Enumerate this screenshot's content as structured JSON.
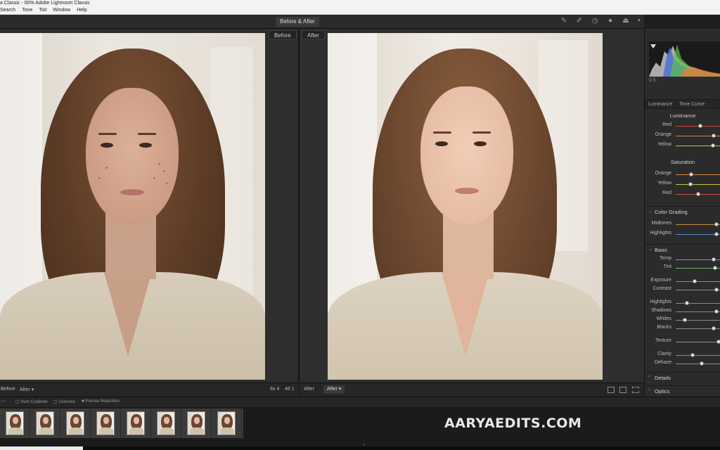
{
  "window": {
    "title": "a Classic - 00% Adobe Lightroom Classic"
  },
  "menu": [
    "Search",
    "Tone",
    "Toit",
    "Window",
    "Help"
  ],
  "toolbar": {
    "view_mode": "Before & After"
  },
  "tool_icons": [
    "brush-icon",
    "pen-icon",
    "clock-icon",
    "info-icon",
    "share-icon",
    "chevron-down-icon"
  ],
  "panes": {
    "before_label": "Before",
    "after_label": "After"
  },
  "bottom_left": {
    "label": "Before",
    "select": "After",
    "zoom": "6x 4",
    "count": "46 1"
  },
  "bottom_right": {
    "label": "After",
    "select": "After"
  },
  "panel": {
    "hist_code": "0 5",
    "tabs": [
      "Luminance",
      "Tone Curve"
    ],
    "luminance": {
      "heading": "Luminance",
      "sliders": [
        {
          "label": "Red",
          "value": 0.55,
          "color": "#d04a4a"
        },
        {
          "label": "Orange",
          "value": 0.85,
          "color": "#d9873a"
        },
        {
          "label": "Yellow",
          "value": 0.83,
          "color": "#c9c13c"
        }
      ]
    },
    "saturation": {
      "heading": "Saturation",
      "sliders": [
        {
          "label": "Orange",
          "value": 0.35,
          "color": "#d9873a"
        },
        {
          "label": "Yellow",
          "value": 0.33,
          "color": "#c9c13c"
        },
        {
          "label": "Red",
          "value": 0.5,
          "color": "#d04a4a"
        }
      ]
    },
    "color_grading": {
      "title": "Color Grading",
      "sliders": [
        {
          "label": "Midtones",
          "value": 0.9,
          "color": "#c98a4a"
        },
        {
          "label": "Highlights",
          "value": 0.9,
          "color": "#5f86c9"
        }
      ]
    },
    "basic": {
      "title": "Basic",
      "sliders": [
        {
          "label": "Temp",
          "value": 0.85,
          "color": "#5f9bd0"
        },
        {
          "label": "Tint",
          "value": 0.88,
          "color": "#6fb26c"
        },
        {
          "label": "Exposure",
          "value": 0.42,
          "color": "#8a8a8a"
        },
        {
          "label": "Contrast",
          "value": 0.9,
          "color": "#8a8a8a"
        },
        {
          "label": "Highlights",
          "value": 0.25,
          "color": "#8a8a8a"
        },
        {
          "label": "Shadows",
          "value": 0.9,
          "color": "#8a8a8a"
        },
        {
          "label": "Whites",
          "value": 0.2,
          "color": "#8a8a8a"
        },
        {
          "label": "Blacks",
          "value": 0.85,
          "color": "#8a8a8a"
        },
        {
          "label": "Texture",
          "value": 0.95,
          "color": "#8a8a8a"
        },
        {
          "label": "Clarity",
          "value": 0.38,
          "color": "#8a8a8a"
        },
        {
          "label": "Dehaze",
          "value": 0.58,
          "color": "#8a8a8a"
        }
      ]
    },
    "details": {
      "title": "Details"
    },
    "optics": {
      "title": "Optics"
    }
  },
  "filmstrip": {
    "bar_items": [
      "Hum Codemie",
      "Usecons",
      "Precise Retachion"
    ],
    "thumbnail_count": 8
  },
  "watermark": "AARYAEDITS.COM"
}
